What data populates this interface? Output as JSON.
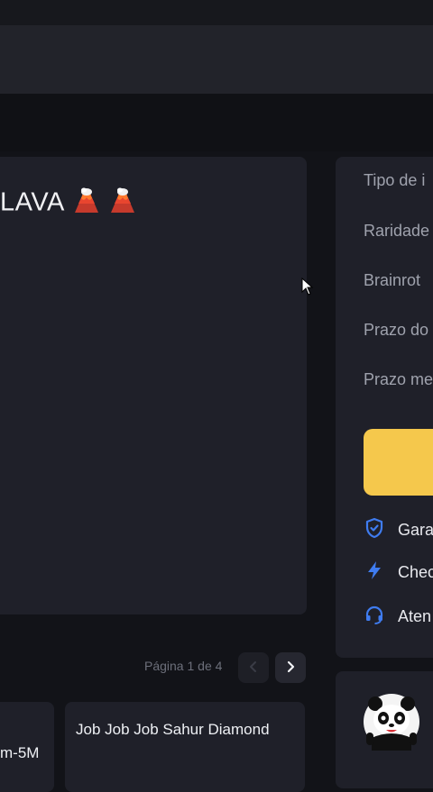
{
  "listing": {
    "title": "LAVA"
  },
  "sidebar": {
    "fields": [
      {
        "label": "Tipo de i"
      },
      {
        "label": "Raridade"
      },
      {
        "label": "Brainrot"
      },
      {
        "label": "Prazo do"
      },
      {
        "label": "Prazo me"
      }
    ],
    "features": [
      {
        "label": "Gara",
        "icon": "shield-check-icon"
      },
      {
        "label": "Chec",
        "icon": "lightning-icon"
      },
      {
        "label": "Aten",
        "icon": "headset-icon"
      }
    ]
  },
  "pagination": {
    "text": "Página 1 de 4"
  },
  "items": [
    {
      "title": "m-5M"
    },
    {
      "title": "Job Job Job Sahur Diamond"
    }
  ],
  "colors": {
    "accent": "#f5c84c",
    "icon_blue": "#3f7cf0",
    "card": "#1f2029",
    "background": "#121318"
  }
}
